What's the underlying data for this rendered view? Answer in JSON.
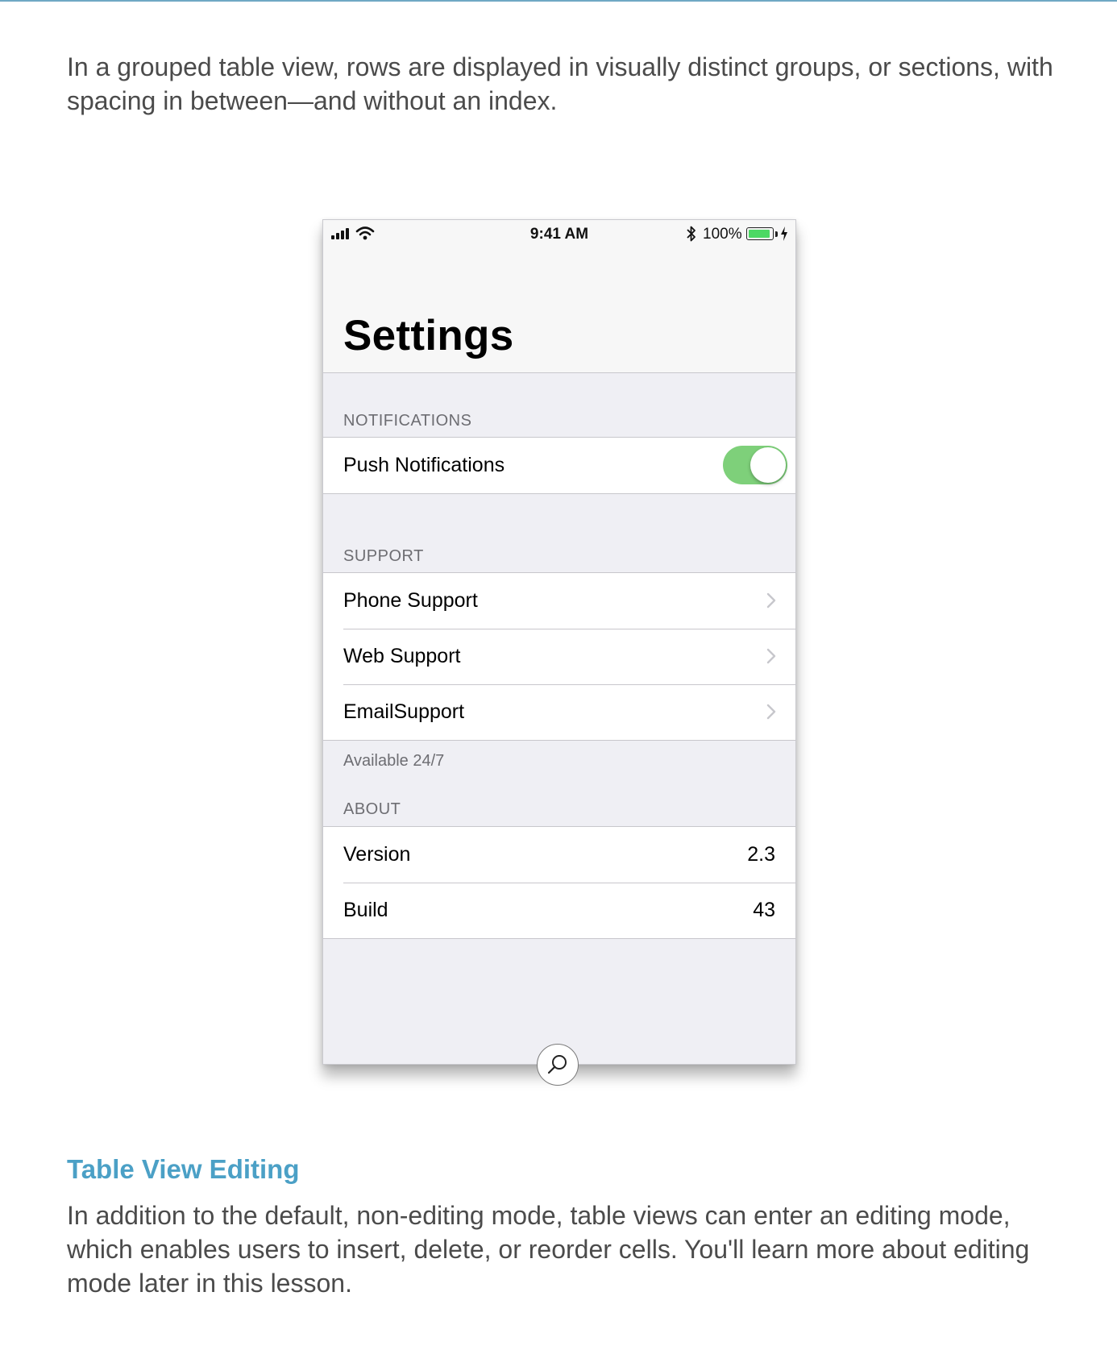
{
  "intro": "In a grouped table view, rows are displayed in visually distinct groups, or sections, with spacing in between—and without an index.",
  "phone": {
    "status": {
      "time": "9:41 AM",
      "battery": "100%"
    },
    "title": "Settings",
    "sections": [
      {
        "header": "NOTIFICATIONS",
        "rows": [
          {
            "label": "Push Notifications",
            "toggle_on": true
          }
        ]
      },
      {
        "header": "SUPPORT",
        "rows": [
          {
            "label": "Phone Support"
          },
          {
            "label": "Web Support"
          },
          {
            "label": "EmailSupport"
          }
        ],
        "footer": "Available 24/7"
      },
      {
        "header": "ABOUT",
        "rows": [
          {
            "label": "Version",
            "value": "2.3"
          },
          {
            "label": "Build",
            "value": "43"
          }
        ]
      }
    ]
  },
  "editing": {
    "heading": "Table View Editing",
    "body": "In addition to the default, non-editing mode, table views can enter an editing mode, which enables users to insert, delete, or reorder cells. You'll learn more about editing mode later in this lesson."
  },
  "icons": [
    "signal-icon",
    "wifi-icon",
    "bluetooth-icon",
    "battery-icon",
    "charging-bolt-icon",
    "chevron-right-icon",
    "search-icon"
  ],
  "colors": {
    "accent": "#4ba0c6",
    "toggle_on": "#7ed07a",
    "battery_fill": "#4cd964"
  }
}
